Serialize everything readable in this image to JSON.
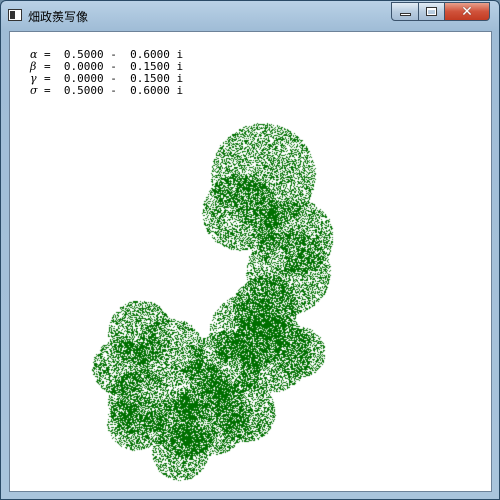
{
  "window": {
    "title": "畑政羨写像",
    "minimize_icon": "minimize-icon",
    "maximize_icon": "maximize-icon",
    "close_icon": "close-icon",
    "close_glyph": "✕"
  },
  "parameters": [
    {
      "name": "α",
      "value": "=  0.5000 -  0.6000 i"
    },
    {
      "name": "β",
      "value": "=  0.0000 -  0.1500 i"
    },
    {
      "name": "γ",
      "value": "=  0.0000 -  0.1500 i"
    },
    {
      "name": "σ",
      "value": "=  0.5000 -  0.6000 i"
    }
  ],
  "colors": {
    "fractal": "#007000",
    "background": "#ffffff"
  }
}
